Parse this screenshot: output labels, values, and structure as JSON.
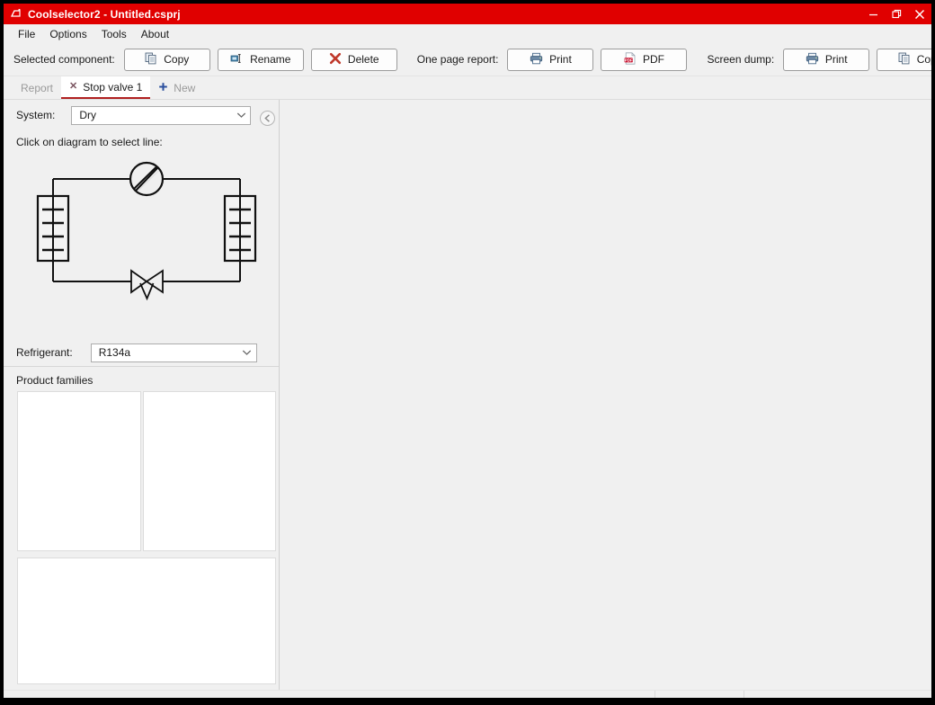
{
  "window": {
    "title": "Coolselector2 - Untitled.csprj",
    "app_icon": "app-logo-icon",
    "controls": {
      "minimize": "minimize-icon",
      "restore": "restore-icon",
      "close": "close-icon"
    },
    "colors": {
      "title_bar": "#e00000",
      "title_text": "#ffffff",
      "window_bg": "#f0f0f0",
      "panel_bg": "#ffffff",
      "accent_tab_underline": "#b02020",
      "delete_icon": "#c0392b",
      "pdf_icon": "#c8102e",
      "printer_icon": "#4a6a8a",
      "diagram_line": "#111111"
    }
  },
  "menu": {
    "items": [
      {
        "label": "File"
      },
      {
        "label": "Options"
      },
      {
        "label": "Tools"
      },
      {
        "label": "About"
      }
    ]
  },
  "toolbar": {
    "groups": [
      {
        "label": "Selected component:",
        "buttons": [
          {
            "label": "Copy",
            "icon": "copy-icon"
          },
          {
            "label": "Rename",
            "icon": "rename-icon"
          },
          {
            "label": "Delete",
            "icon": "delete-x-icon"
          }
        ]
      },
      {
        "label": "One page report:",
        "buttons": [
          {
            "label": "Print",
            "icon": "printer-icon"
          },
          {
            "label": "PDF",
            "icon": "pdf-icon"
          }
        ]
      },
      {
        "label": "Screen dump:",
        "buttons": [
          {
            "label": "Print",
            "icon": "printer-icon"
          },
          {
            "label": "Copy",
            "icon": "copy-icon"
          }
        ]
      }
    ]
  },
  "tabs": {
    "items": [
      {
        "label": "Report",
        "active": false,
        "closable": false
      },
      {
        "label": "Stop valve 1",
        "active": true,
        "closable": true,
        "close_glyph": "✕"
      },
      {
        "label": "New",
        "active": false,
        "closable": false,
        "plus_glyph": "＋"
      }
    ]
  },
  "left_panel": {
    "system": {
      "label": "System:",
      "value": "Dry",
      "arrow_icon": "chevron-down-icon"
    },
    "collapse_button": {
      "icon": "chevron-left-circle-icon"
    },
    "diagram": {
      "hint": "Click on diagram to select line:",
      "components": [
        {
          "name": "compressor",
          "shape": "circle-with-chord"
        },
        {
          "name": "evaporator",
          "shape": "heat-exchanger-rect",
          "position": "left"
        },
        {
          "name": "condenser",
          "shape": "heat-exchanger-rect",
          "position": "right"
        },
        {
          "name": "expansion-valve",
          "shape": "bowtie-valve",
          "position": "bottom"
        }
      ]
    },
    "refrigerant": {
      "label": "Refrigerant:",
      "value": "R134a",
      "arrow_icon": "chevron-down-icon"
    },
    "product_families": {
      "header": "Product families",
      "panels": [
        {
          "name": "family-list-left",
          "content": ""
        },
        {
          "name": "family-list-right",
          "content": ""
        },
        {
          "name": "family-detail-bottom",
          "content": ""
        }
      ]
    }
  },
  "main_area": {
    "content": ""
  }
}
